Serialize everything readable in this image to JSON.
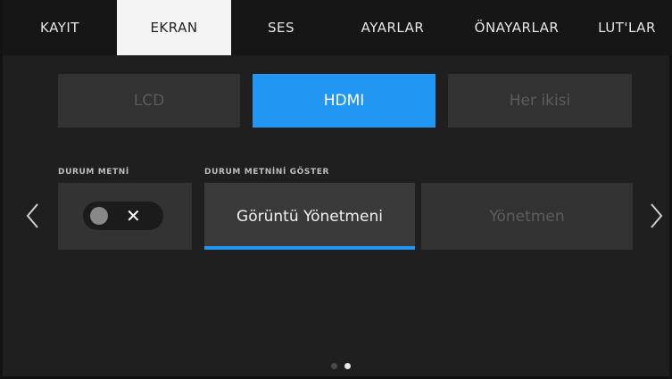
{
  "tabs": [
    {
      "label": "KAYIT",
      "active": false
    },
    {
      "label": "EKRAN",
      "active": true
    },
    {
      "label": "SES",
      "active": false
    },
    {
      "label": "AYARLAR",
      "active": false
    },
    {
      "label": "ÖNAYARLAR",
      "active": false
    },
    {
      "label": "LUT'LAR",
      "active": false
    }
  ],
  "output_selector": {
    "options": [
      "LCD",
      "HDMI",
      "Her ikisi"
    ],
    "selected": "HDMI"
  },
  "status_text": {
    "label": "DURUM METNİ",
    "toggle_value": "off",
    "toggle_symbol": "✕"
  },
  "show_status_text": {
    "label": "DURUM METNİNİ GÖSTER",
    "options": [
      "Görüntü Yönetmeni",
      "Yönetmen"
    ],
    "selected": "Görüntü Yönetmeni"
  },
  "pagination": {
    "pages": 2,
    "current": 2
  },
  "colors": {
    "accent": "#2196f3",
    "tab_active_bg": "#f4f4f4",
    "tile_bg": "#333333"
  },
  "icons": {
    "left": "chevron-left-icon",
    "right": "chevron-right-icon"
  }
}
